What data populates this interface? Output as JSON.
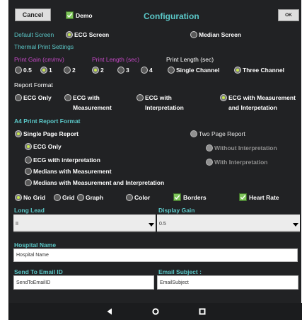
{
  "header": {
    "cancel_label": "Cancel",
    "demo_label": "Demo",
    "title": "Configuration",
    "ok_label": "OK"
  },
  "default_screen": {
    "label": "Default Screen",
    "ecg": "ECG Screen",
    "median": "Median Screen"
  },
  "thermal": {
    "section": "Thermal Print Settings",
    "gain_label": "Print Gain (cm/mv)",
    "length_label": "Print Length (sec)",
    "length_label2": "Print Length (sec)",
    "gain_opts": [
      "0.5",
      "1",
      "2"
    ],
    "length_opts": [
      "2",
      "3",
      "4"
    ],
    "channel_opts": [
      "Single Channel",
      "Three Channel"
    ]
  },
  "report_format": {
    "label": "Report Format",
    "ecg_only": "ECG Only",
    "ecg_meas_1": "ECG with",
    "ecg_meas_2": "Measurement",
    "ecg_interp_1": "ECG with",
    "ecg_interp_2": "Interpretation",
    "ecg_mi_1": "ECG with Measurement",
    "ecg_mi_2": "and Interpetation"
  },
  "a4": {
    "section": "A4 Print Report Format",
    "single_page": "Single Page Report",
    "two_page": "Two Page Report",
    "ecg_only": "ECG Only",
    "without_interp": "Without Interpretation",
    "ecg_with_interp": "ECG with interpretation",
    "with_interp": "With Interpretation",
    "medians_meas": "Medians with Measurement",
    "medians_meas_interp": "Medians with Measurement and Interpretation"
  },
  "grid_opts": {
    "no_grid": "No Grid",
    "grid": "Grid",
    "graph": "Graph",
    "color": "Color",
    "borders": "Borders",
    "heart_rate": "Heart Rate"
  },
  "long_lead": {
    "label": "Long Lead",
    "value": "II"
  },
  "display_gain": {
    "label": "Display Gain",
    "value": "0.5"
  },
  "hospital": {
    "label": "Hospital Name",
    "placeholder": "Hospital Name"
  },
  "email": {
    "label": "Send To Email ID",
    "placeholder": "SendToEmailID",
    "subject_label": "Email Subject :",
    "subject_placeholder": "EmailSubject"
  },
  "colors": {
    "accent": "#5bc8c8",
    "magenta": "#c548c5",
    "bg": "#212224",
    "radio_dot": "#c6e84a",
    "check": "#7fc65b"
  },
  "nav_icons": [
    "back-icon",
    "home-icon",
    "recents-icon"
  ]
}
